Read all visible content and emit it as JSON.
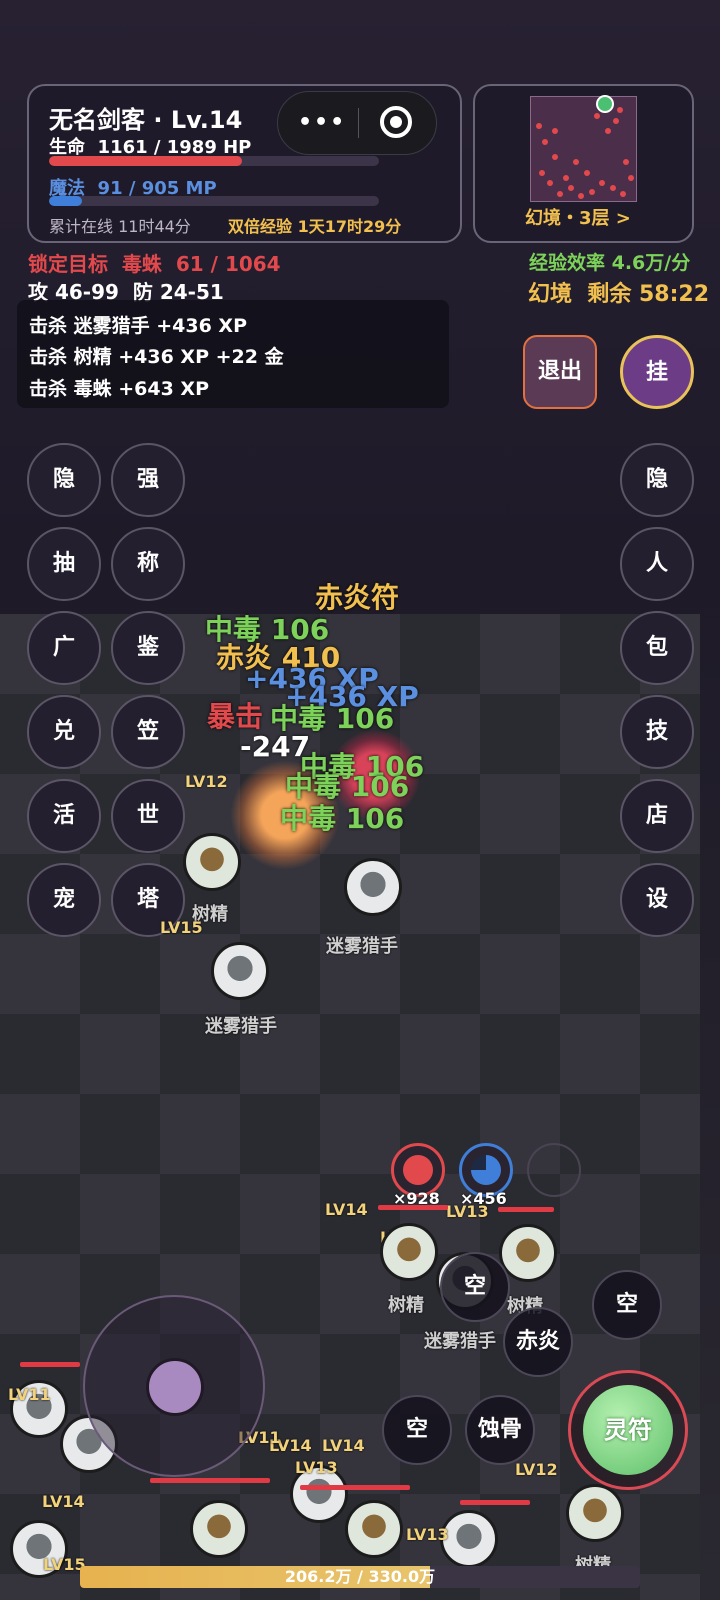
{
  "player": {
    "title": "无名剑客 · Lv.14",
    "hp_label": "生命",
    "hp_value": "1161 / 1989 HP",
    "hp_ratio": 0.584,
    "mp_label": "魔法",
    "mp_value": "91 / 905 MP",
    "mp_ratio": 0.1,
    "online": "累计在线 11时44分",
    "double_xp": "双倍经验 1天17时29分"
  },
  "capsule": {
    "dots": "•••"
  },
  "minimap": {
    "label": "幻境・3层 >"
  },
  "target": {
    "label": "锁定目标",
    "name": "毒蛛",
    "hp": "61 / 1064"
  },
  "stats": {
    "attack": "攻 46-99",
    "defense": "防 24-51"
  },
  "efficiency": "经验效率 4.6万/分",
  "realm_label": "幻境",
  "remaining": "剩余 58:22",
  "kill_log": [
    "击杀 迷雾猎手 +436 XP",
    "击杀 树精 +436 XP +22 金",
    "击杀 毒蛛 +643 XP"
  ],
  "buttons": {
    "exit": "退出",
    "hang": "挂"
  },
  "menu_left_a": [
    "隐",
    "抽",
    "广",
    "兑",
    "活",
    "宠"
  ],
  "menu_left_b": [
    "强",
    "称",
    "鉴",
    "笠",
    "世",
    "塔"
  ],
  "menu_right": [
    "隐",
    "人",
    "包",
    "技",
    "店",
    "设"
  ],
  "floating_texts": [
    "赤炎符",
    "中毒 106",
    "赤炎 410",
    "+436 XP",
    "+436 XP",
    "暴击",
    "中毒 106",
    "-247",
    "中毒 106",
    "中毒 106",
    "中毒 106"
  ],
  "mobs": {
    "tree": "树精",
    "hunter": "迷雾猎手",
    "levels": [
      "LV14",
      "LV13",
      "LV14",
      "LV15",
      "LV12",
      "LV12",
      "LV11",
      "LV14",
      "LV14",
      "LV13",
      "LV14",
      "LV13",
      "LV15",
      "LV11"
    ]
  },
  "potions": {
    "red_count": "×928",
    "blue_count": "×456"
  },
  "skills": {
    "empty": "空",
    "chiyan": "赤炎",
    "shigu": "蚀骨",
    "lingfu": "灵符"
  },
  "xp": {
    "text": "206.2万 / 330.0万",
    "ratio": 0.625
  },
  "colors": {
    "hp": "#e2494c",
    "mp": "#3f7fd9",
    "accent": "#f2c04e",
    "green": "#7dd25a"
  }
}
